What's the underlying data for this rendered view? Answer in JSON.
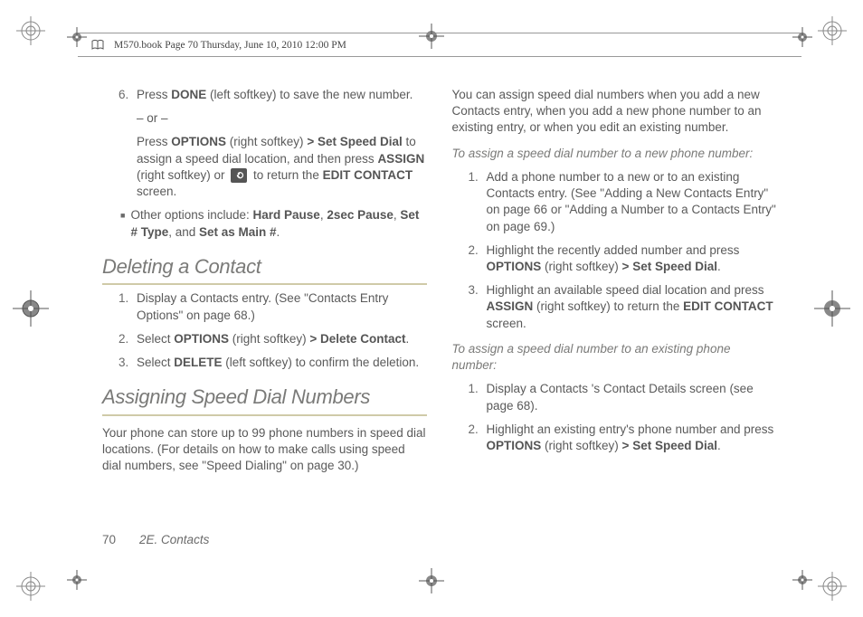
{
  "header": {
    "text": "M570.book  Page 70  Thursday, June 10, 2010  12:00 PM"
  },
  "col1": {
    "step6": {
      "num": "6.",
      "text_a": "Press ",
      "done": "DONE",
      "text_b": " (left softkey) to save the new number."
    },
    "or": "– or –",
    "step6b": {
      "a": "Press ",
      "options": "OPTIONS",
      "b": " (right softkey) ",
      "gt": ">",
      "ssd": " Set Speed Dial",
      "c": " to assign a speed dial location, and then press ",
      "assign": "ASSIGN",
      "d": " (right softkey) or ",
      "e": " to return the ",
      "edit": "EDIT CONTACT",
      "f": " screen."
    },
    "bullet": {
      "a": "Other options include: ",
      "hp": "Hard Pause",
      "c1": ", ",
      "tp": "2sec Pause",
      "c2": ", ",
      "st": "Set # Type",
      "c3": ", and ",
      "sm": "Set as Main #",
      "c4": "."
    },
    "h_delete": "Deleting a Contact",
    "del1": {
      "num": "1.",
      "text": "Display a Contacts entry. (See \"Contacts Entry Options\" on page 68.)"
    },
    "del2": {
      "num": "2.",
      "a": "Select ",
      "options": "OPTIONS",
      "b": " (right softkey) ",
      "gt": ">",
      "dc": " Delete Contact",
      "c": "."
    },
    "del3": {
      "num": "3.",
      "a": "Select ",
      "delete": "DELETE",
      "b": " (left softkey) to confirm the deletion."
    },
    "h_assign": "Assigning Speed Dial Numbers",
    "assign_para": "Your phone can store up to 99 phone numbers in speed dial locations. (For details on how to make calls using speed dial numbers, see \"Speed Dialing\" on page 30.)"
  },
  "col2": {
    "para1": "You can assign speed dial numbers when you add a new Contacts entry, when you add a new phone number to an existing entry, or when you edit an existing number.",
    "intro1": "To assign a speed dial number to a new phone number:",
    "s1": {
      "num": "1.",
      "text": "Add a phone number to a new or to an existing Contacts entry. (See \"Adding a New Contacts Entry\" on page 66 or \"Adding a Number to a Contacts Entry\" on page 69.)"
    },
    "s2": {
      "num": "2.",
      "a": "Highlight the recently added number and press ",
      "options": "OPTIONS",
      "b": " (right softkey) ",
      "gt": ">",
      "ssd": " Set Speed Dial",
      "c": "."
    },
    "s3": {
      "num": "3.",
      "a": "Highlight an available speed dial location and press ",
      "assign": "ASSIGN",
      "b": " (right softkey) to return the ",
      "edit": "EDIT CONTACT",
      "c": " screen."
    },
    "intro2": "To assign a speed dial number to an existing phone number:",
    "e1": {
      "num": "1.",
      "text": "Display a Contacts 's Contact Details screen (see page 68)."
    },
    "e2": {
      "num": "2.",
      "a": "Highlight an existing entry's phone number and press ",
      "options": "OPTIONS",
      "b": " (right softkey) ",
      "gt": ">",
      "ssd": " Set Speed Dial",
      "c": "."
    }
  },
  "footer": {
    "page": "70",
    "section": "2E. Contacts"
  }
}
